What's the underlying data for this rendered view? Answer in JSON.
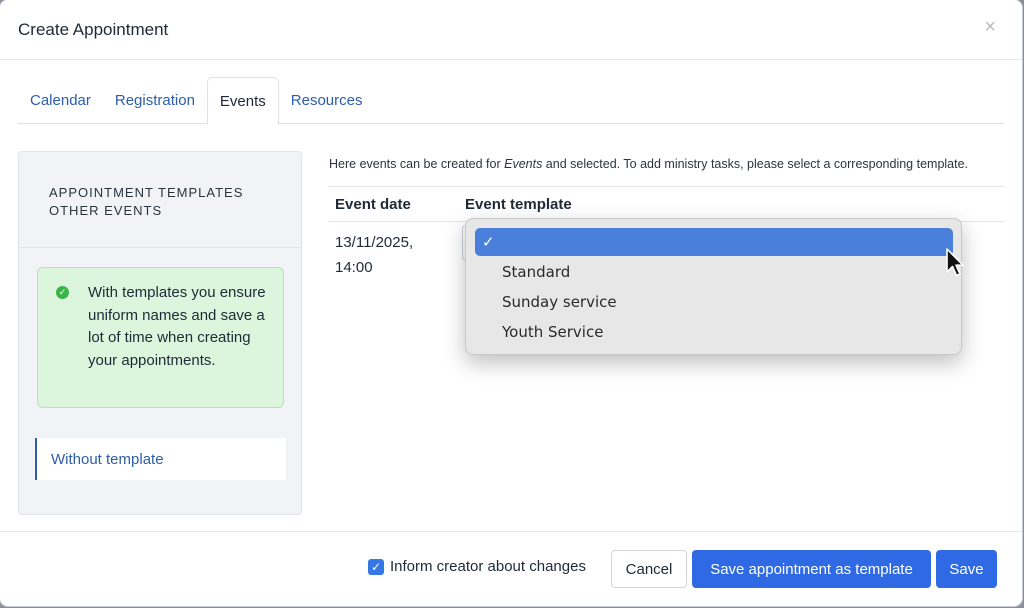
{
  "dialog": {
    "title": "Create Appointment",
    "close_symbol": "×"
  },
  "tabs": [
    {
      "label": "Calendar"
    },
    {
      "label": "Registration"
    },
    {
      "label": "Events"
    },
    {
      "label": "Resources"
    }
  ],
  "sidebar": {
    "header_line1": "APPOINTMENT TEMPLATES",
    "header_line2": "OTHER EVENTS",
    "info_text": "With templates you ensure uniform names and save a lot of time when creating your appointments.",
    "without_template_label": "Without template"
  },
  "content": {
    "intro_before": "Here events can be created for ",
    "intro_em": "Events",
    "intro_after": " and selected. To add ministry tasks, please select a corresponding template.",
    "col_date": "Event date",
    "col_template": "Event template",
    "row_date_line1": "13/11/2025,",
    "row_date_line2": "14:00"
  },
  "dropdown": {
    "selected_check": "✓",
    "options": [
      {
        "label": "Standard"
      },
      {
        "label": "Sunday service"
      },
      {
        "label": "Youth Service"
      }
    ]
  },
  "footer": {
    "inform_label": "Inform creator about changes",
    "inform_checked": true,
    "cancel_label": "Cancel",
    "save_template_label": "Save appointment as template",
    "save_label": "Save"
  },
  "colors": {
    "primary": "#2f6ae4",
    "link": "#2f5da8",
    "info_bg": "#dcf6dd",
    "dropdown_highlight": "#4a7fdc"
  }
}
